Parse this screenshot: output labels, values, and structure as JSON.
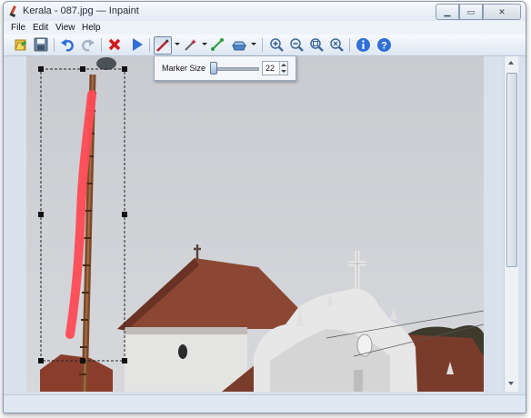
{
  "window": {
    "title": "Kerala - 087.jpg — Inpaint"
  },
  "menu": [
    "File",
    "Edit",
    "View",
    "Help"
  ],
  "toolbar": {
    "icons": [
      "open-icon",
      "save-icon",
      "undo-icon",
      "redo-icon",
      "delete-icon",
      "run-icon",
      "marker-icon",
      "magic-wand-icon",
      "line-icon",
      "eraser-icon",
      "zoom-in-icon",
      "zoom-out-icon",
      "zoom-fit-icon",
      "zoom-actual-icon",
      "info-icon",
      "help-icon"
    ]
  },
  "marker_popup": {
    "label": "Marker Size",
    "value": "22",
    "slider_fraction": 0.05
  },
  "colors": {
    "accent": "#2f6fd6",
    "mask": "#ff4b55",
    "delete": "#d11a1a"
  }
}
